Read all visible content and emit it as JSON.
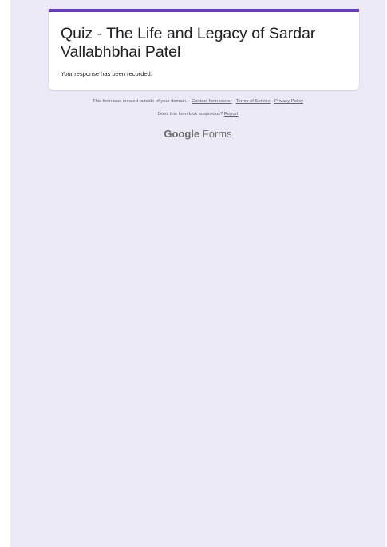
{
  "form": {
    "title": "Quiz - The Life and Legacy of Sardar Vallabhbhai Patel",
    "response_message": "Your response has been recorded.",
    "accent_color": "#673ab7"
  },
  "footer": {
    "domain_notice": "This form was created outside of your domain.",
    "separator": " - ",
    "contact_link": "Contact form owner",
    "terms_link": "Terms of Service",
    "privacy_link": "Privacy Policy",
    "suspicious_text": "Does this form look suspicious?",
    "report_link": "Report"
  },
  "branding": {
    "google": "Google",
    "forms": "Forms"
  },
  "colors": {
    "page_background": "#ece9f6",
    "card_background": "#ffffff",
    "footer_text": "#5f6368"
  }
}
